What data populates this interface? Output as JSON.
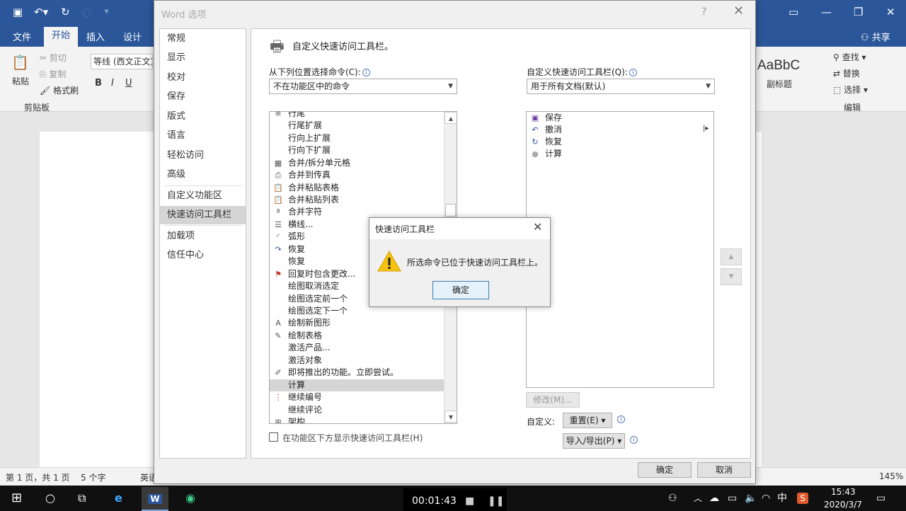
{
  "word": {
    "tabs": [
      "文件",
      "开始",
      "插入",
      "设计"
    ],
    "share": "共享",
    "clipboard": {
      "paste": "粘贴",
      "cut": "剪切",
      "copy": "复制",
      "format_painter": "格式刷",
      "group": "剪贴板"
    },
    "font_box": "等线 (西文正文)",
    "style_sample": "AaBbC",
    "style_name": "副标题",
    "editing": {
      "find": "查找",
      "replace": "替换",
      "select": "选择",
      "group": "编辑"
    },
    "status": {
      "page": "第 1 页，共 1 页",
      "words": "5 个字",
      "lang": "英语",
      "zoom": "145%"
    }
  },
  "taskbar": {
    "recording_time": "00:01:43",
    "ime": "中",
    "time": "15:43",
    "date": "2020/3/7"
  },
  "options": {
    "title": "Word 选项",
    "help": "?",
    "nav": [
      "常规",
      "显示",
      "校对",
      "保存",
      "版式",
      "语言",
      "轻松访问",
      "高级",
      "自定义功能区",
      "快速访问工具栏",
      "加载项",
      "信任中心"
    ],
    "heading": "自定义快速访问工具栏。",
    "choose_label": "从下列位置选择命令(C):",
    "choose_value": "不在功能区中的命令",
    "customize_label": "自定义快速访问工具栏(Q):",
    "customize_value": "用于所有文档(默认)",
    "commands": [
      "行尾",
      "行尾扩展",
      "行向上扩展",
      "行向下扩展",
      "合并/拆分单元格",
      "合并到传真",
      "合并粘贴表格",
      "合并粘贴列表",
      "合并字符",
      "横线...",
      "弧形",
      "恢复",
      "恢复",
      "回复时包含更改...",
      "绘图取消选定",
      "绘图选定前一个",
      "绘图选定下一个",
      "绘制新图形",
      "绘制表格",
      "激活产品...",
      "激活对象",
      "即将推出的功能。立即尝试。",
      "计算",
      "继续编号",
      "继续评论",
      "架构"
    ],
    "selected_command": "计算",
    "qat_items": [
      "保存",
      "撤消",
      "恢复",
      "计算"
    ],
    "modify": "修改(M)...",
    "custom_label": "自定义:",
    "reset": "重置(E)",
    "import_export": "导入/导出(P)",
    "show_below": "在功能区下方显示快速访问工具栏(H)",
    "ok": "确定",
    "cancel": "取消"
  },
  "message": {
    "title": "快速访问工具栏",
    "text": "所选命令已位于快速访问工具栏上。",
    "ok": "确定"
  }
}
